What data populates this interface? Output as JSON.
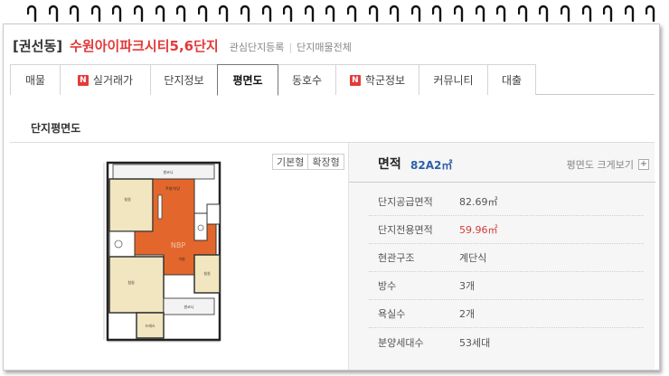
{
  "header": {
    "region": "[권선동]",
    "complex_name": "수원아이파크시티5,6단지",
    "favorite_link": "관심단지등록",
    "all_listings_link": "단지매물전체"
  },
  "tabs": [
    {
      "label": "매물",
      "badge": ""
    },
    {
      "label": "실거래가",
      "badge": "N"
    },
    {
      "label": "단지정보",
      "badge": ""
    },
    {
      "label": "평면도",
      "badge": "",
      "active": true
    },
    {
      "label": "동호수",
      "badge": ""
    },
    {
      "label": "학군정보",
      "badge": "N"
    },
    {
      "label": "커뮤니티",
      "badge": ""
    },
    {
      "label": "대출",
      "badge": ""
    }
  ],
  "section_title": "단지평면도",
  "plan_type_buttons": {
    "basic": "기본형",
    "extended": "확장형"
  },
  "floorplan": {
    "watermark": "NBP",
    "rooms": [
      "발코니",
      "침실",
      "주방/식당",
      "거실",
      "침실",
      "침실",
      "발코니",
      "드레스"
    ]
  },
  "area": {
    "label": "면적",
    "type": "82A2㎡",
    "enlarge_link": "평면도 크게보기",
    "enlarge_icon": "+"
  },
  "details": [
    {
      "key": "단지공급면적",
      "value": "82.69㎡",
      "highlight": false
    },
    {
      "key": "단지전용면적",
      "value": "59.96㎡",
      "highlight": true
    },
    {
      "key": "현관구조",
      "value": "계단식",
      "highlight": false
    },
    {
      "key": "방수",
      "value": "3개",
      "highlight": false
    },
    {
      "key": "욕실수",
      "value": "2개",
      "highlight": false
    },
    {
      "key": "분양세대수",
      "value": "53세대",
      "highlight": false
    }
  ],
  "colors": {
    "accent_red": "#e23a3a",
    "area_blue": "#2e5fa8",
    "floor_wood": "#e3672c"
  }
}
